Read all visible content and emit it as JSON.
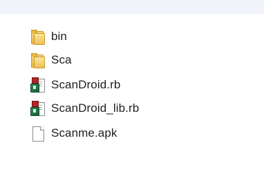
{
  "files": [
    {
      "name": "bin",
      "icon": "folder-icon"
    },
    {
      "name": "Sca",
      "icon": "folder-icon"
    },
    {
      "name": "ScanDroid.rb",
      "icon": "ruby-file-icon"
    },
    {
      "name": "ScanDroid_lib.rb",
      "icon": "ruby-file-icon"
    },
    {
      "name": "Scanme.apk",
      "icon": "file-icon"
    }
  ]
}
